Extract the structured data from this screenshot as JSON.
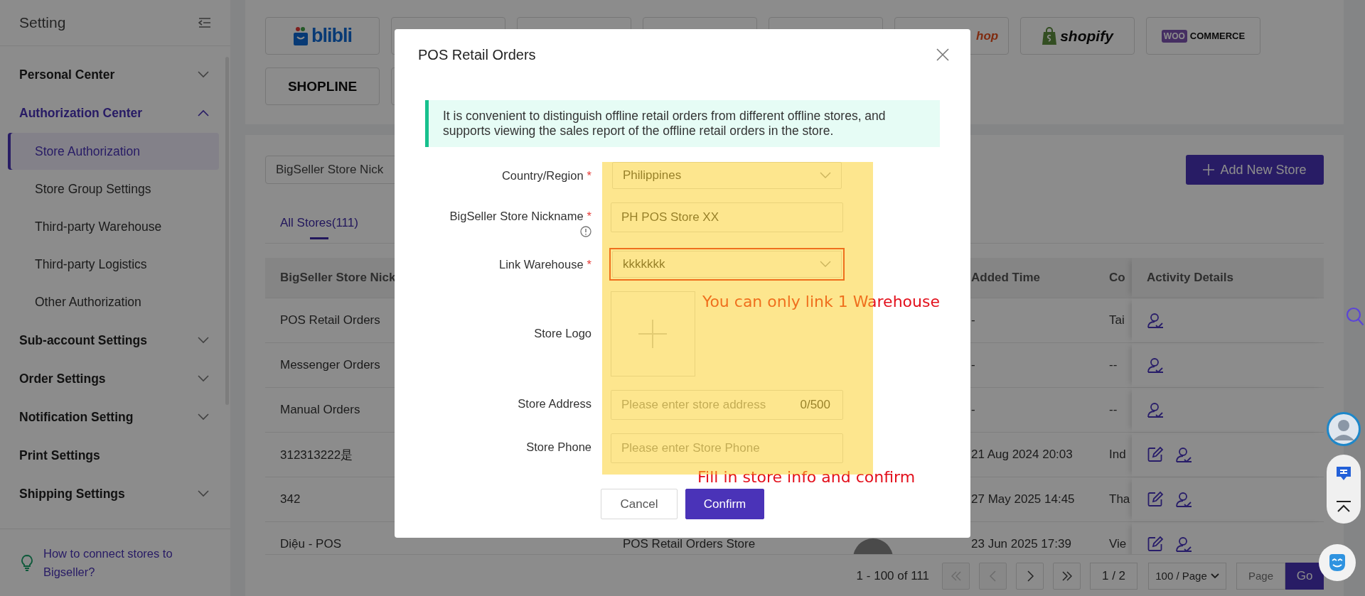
{
  "sidebar": {
    "title": "Setting",
    "items": [
      {
        "label": "Personal Center",
        "selected": false,
        "expandable": true,
        "expanded": false
      },
      {
        "label": "Authorization Center",
        "selected": true,
        "expandable": true,
        "expanded": true,
        "children": [
          {
            "label": "Store Authorization",
            "selected": true
          },
          {
            "label": "Store Group Settings",
            "selected": false
          },
          {
            "label": "Third-party Warehouse",
            "selected": false
          },
          {
            "label": "Third-party Logistics",
            "selected": false
          },
          {
            "label": "Other Authorization",
            "selected": false
          }
        ]
      },
      {
        "label": "Sub-account Settings",
        "selected": false,
        "expandable": true,
        "expanded": false
      },
      {
        "label": "Order Settings",
        "selected": false,
        "expandable": true,
        "expanded": false
      },
      {
        "label": "Notification Setting",
        "selected": false,
        "expandable": true,
        "expanded": false
      },
      {
        "label": "Print Settings",
        "selected": false,
        "expandable": false,
        "expanded": false
      },
      {
        "label": "Shipping Settings",
        "selected": false,
        "expandable": true,
        "expanded": false
      }
    ],
    "help_link": "How to connect stores to Bigseller?"
  },
  "platforms": [
    [
      {
        "kind": "blibli",
        "label": "blibli"
      },
      {
        "kind": "blank"
      },
      {
        "kind": "blank"
      },
      {
        "kind": "blank"
      },
      {
        "kind": "blank"
      },
      {
        "kind": "partial",
        "label": "hop"
      },
      {
        "kind": "shopify",
        "label": "shopify"
      },
      {
        "kind": "woocommerce",
        "label": "WOO",
        "label2": "COMMERCE"
      }
    ],
    [
      {
        "kind": "shopline",
        "label": "SHOPLINE"
      },
      {
        "kind": "blank"
      }
    ]
  ],
  "store_filter": {
    "value": "BigSeller Store Nick"
  },
  "add_button": "Add New Store",
  "tabs": [
    {
      "label": "All Stores(111)",
      "selected": true
    }
  ],
  "table": {
    "columns": [
      {
        "label": "BigSeller Store Nick"
      },
      {
        "label": "Added Time"
      },
      {
        "label": "Co"
      },
      {
        "label": "Activity Details"
      }
    ],
    "rows": [
      {
        "nickname": "POS Retail Orders",
        "added_time": "-",
        "country": "Tai",
        "editable": false
      },
      {
        "nickname": "Messenger Orders",
        "added_time": "-",
        "country": "--",
        "editable": false
      },
      {
        "nickname": "Manual Orders",
        "added_time": "-",
        "country": "--",
        "editable": false
      },
      {
        "nickname": "312313222是",
        "added_time": "21 Aug 2024 20:03",
        "country": "Ind",
        "editable": true
      },
      {
        "nickname": "342",
        "added_time": "27 May 2025 14:45",
        "country": "Tha",
        "editable": true
      },
      {
        "nickname": "Diệu - POS",
        "platform": "POS Retail Orders Store",
        "logo": true,
        "added_time": "23 Jun 2025 17:39",
        "country": "Vie",
        "editable": true
      }
    ]
  },
  "pagination": {
    "summary": "1 - 100 of 111",
    "nav": [
      {
        "kind": "first",
        "disabled": true
      },
      {
        "kind": "prev",
        "disabled": true
      },
      {
        "kind": "next",
        "disabled": false
      },
      {
        "kind": "last",
        "disabled": false
      }
    ],
    "page": "1 / 2",
    "page_size": "100 / Page",
    "jump_placeholder": "Page",
    "go": "Go"
  },
  "modal": {
    "title": "POS Retail Orders",
    "notice": "It is convenient to distinguish offline retail orders from different offline stores, and supports viewing the sales report of the offline retail orders in the store.",
    "form_highlight": true,
    "fields": [
      {
        "kind": "select",
        "label": "Country/Region",
        "mark": "*",
        "value": "Philippines"
      },
      {
        "kind": "text",
        "label": "BigSeller Store Nickname",
        "mark": "*",
        "info": true,
        "value": "PH POS Store XX"
      },
      {
        "kind": "select",
        "label": "Link Warehouse",
        "mark": "*",
        "value": "kkkkkkk",
        "highlighted": true
      },
      {
        "kind": "upload",
        "label": "Store Logo",
        "note": "You can only link 1 Warehouse"
      },
      {
        "kind": "text",
        "label": "Store Address",
        "placeholder": "Please enter store address",
        "counter": "0/500"
      },
      {
        "kind": "text",
        "label": "Store Phone",
        "placeholder": "Please enter Store Phone"
      }
    ],
    "buttons_note": "Fill in store info and confirm",
    "buttons": [
      {
        "kind": "secondary",
        "label": "Cancel"
      },
      {
        "kind": "primary",
        "label": "Confirm"
      }
    ]
  }
}
